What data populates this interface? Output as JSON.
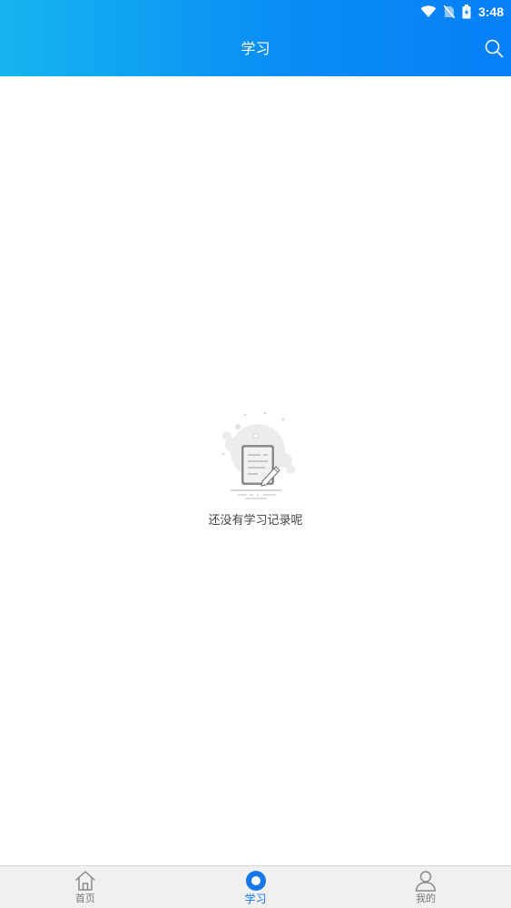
{
  "status_bar": {
    "time": "3:48",
    "icons": [
      "wifi-icon",
      "no-sim-icon",
      "battery-charging-icon"
    ]
  },
  "header": {
    "title": "学习",
    "search_icon": "search-icon"
  },
  "empty_state": {
    "illustration": "empty-notebook-illustration",
    "message": "还没有学习记录呢"
  },
  "tabbar": {
    "items": [
      {
        "label": "首页",
        "icon": "home-icon",
        "active": false
      },
      {
        "label": "学习",
        "icon": "study-circle-icon",
        "active": true
      },
      {
        "label": "我的",
        "icon": "user-icon",
        "active": false
      }
    ]
  },
  "colors": {
    "header_gradient_start": "#16b4f0",
    "header_gradient_end": "#067ff7",
    "active_tab": "#1677e8",
    "inactive_tab": "#777777"
  }
}
